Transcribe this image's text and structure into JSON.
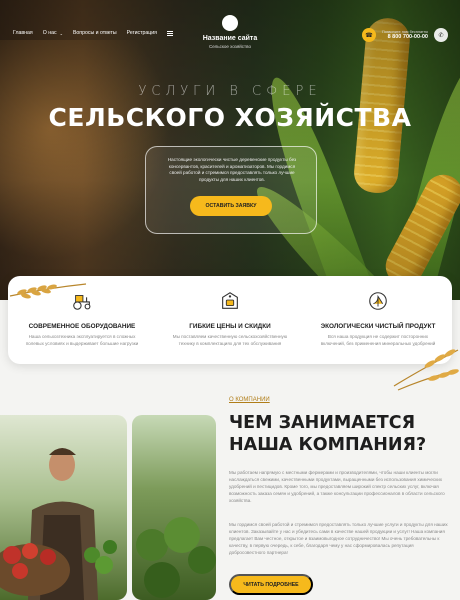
{
  "nav": {
    "items": [
      {
        "label": "Главная"
      },
      {
        "label": "О нас"
      },
      {
        "label": "Вопросы и ответы"
      },
      {
        "label": "Регистрация"
      }
    ]
  },
  "brand": {
    "name": "Название сайта",
    "subtitle": "Сельское хозяйство"
  },
  "contact": {
    "phone_label": "Позвоните нам бесплатно",
    "phone": "8 800 700-00-00"
  },
  "hero": {
    "kicker": "УСЛУГИ В СФЕРЕ",
    "title": "СЕЛЬСКОГО ХОЗЯЙСТВА",
    "description": "Настоящие экологически чистые деревенские продукты без консервантов, красителей и ароматизаторов. Мы гордимся своей работой и стремимся предоставлять только лучшие продукты для наших клиентов.",
    "cta_label": "ОСТАВИТЬ ЗАЯВКУ"
  },
  "features": [
    {
      "icon": "tractor-icon",
      "title": "СОВРЕМЕННОЕ ОБОРУДОВАНИЕ",
      "desc": "Наша сельхозтехника эксплуатируется в сложных полевых условиях и выдерживает большие нагрузки"
    },
    {
      "icon": "price-tag-icon",
      "title": "ГИБКИЕ ЦЕНЫ И СКИДКИ",
      "desc": "Мы поставляем качественную сельскохозяйственную технику в комплектациях для тех обслуживания"
    },
    {
      "icon": "eco-plant-icon",
      "title": "ЭКОЛОГИЧЕСКИ ЧИСТЫЙ ПРОДУКТ",
      "desc": "Вся наша продукция не содержит посторонних включений, без применения минеральных удобрений"
    }
  ],
  "about": {
    "eyebrow": "О КОМПАНИИ",
    "title": "ЧЕМ ЗАНИМАЕТСЯ НАША КОМПАНИЯ?",
    "p1": "Мы работаем напрямую с местными фермерами и производителями, чтобы наши клиенты могли наслаждаться свежими, качественными продуктами, выращенными без использования химических удобрений и пестицидов. Кроме того, мы предоставляем широкий спектр сельских услуг, включая возможность заказа семян и удобрений, а также консультации профессионалов в области сельского хозяйства.",
    "p2": "Мы гордимся своей работой и стремимся предоставлять только лучшие услуги и продукты для наших клиентов. Заказывайте у нас и убедитесь сами в качестве нашей продукции и услуг! Наша компания предлагает Вам честное, открытое и взаимовыгодное сотрудничество! Мы очень требовательны к качеству, в первую очередь, к себе, благодаря чему у нас сформировалась репутация добросовестного партнера!",
    "button_label": "ЧИТАТЬ ПОДРОБНЕЕ"
  },
  "colors": {
    "accent": "#f6b91c",
    "eyebrow": "#b07d18"
  }
}
